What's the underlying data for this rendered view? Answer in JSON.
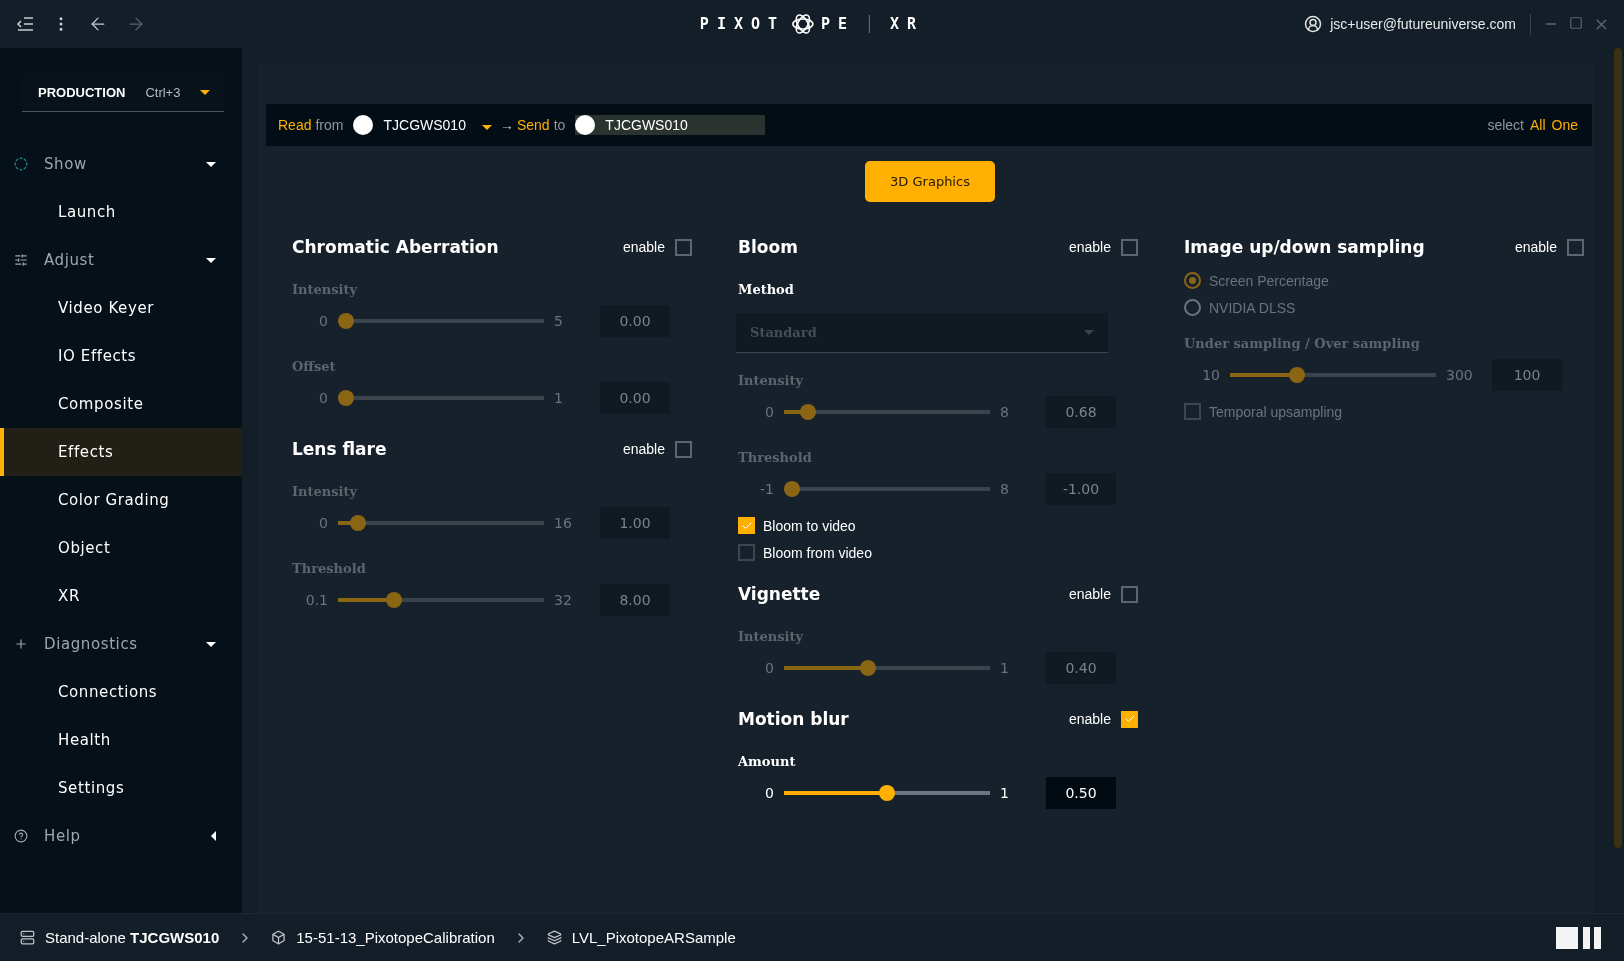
{
  "topbar": {
    "logo_left": "PIXOT",
    "logo_right": "PE",
    "product": "XR",
    "user": "jsc+user@futureuniverse.com"
  },
  "sidebar": {
    "mode": "PRODUCTION",
    "shortcut": "Ctrl+3",
    "groups": [
      {
        "label": "Show",
        "expanded": true,
        "children": [
          {
            "label": "Launch",
            "selected": false
          }
        ]
      },
      {
        "label": "Adjust",
        "expanded": true,
        "children": [
          {
            "label": "Video Keyer",
            "selected": false
          },
          {
            "label": "IO Effects",
            "selected": false
          },
          {
            "label": "Composite",
            "selected": false
          },
          {
            "label": "Effects",
            "selected": true
          },
          {
            "label": "Color Grading",
            "selected": false
          },
          {
            "label": "Object",
            "selected": false
          },
          {
            "label": "XR",
            "selected": false
          }
        ]
      },
      {
        "label": "Diagnostics",
        "expanded": true,
        "children": [
          {
            "label": "Connections",
            "selected": false
          },
          {
            "label": "Health",
            "selected": false
          },
          {
            "label": "Settings",
            "selected": false
          }
        ]
      },
      {
        "label": "Help",
        "expanded": false
      }
    ]
  },
  "route_bar": {
    "read": "Read",
    "read_suffix": "from",
    "source": "TJCGWS010",
    "send_prefix": "→",
    "send_word": "Send",
    "send_suffix": "to",
    "target": "TJCGWS010",
    "select": "select",
    "all": "All",
    "one": "One"
  },
  "category_button": "3D Graphics",
  "columns": [
    [
      {
        "title": "Chromatic Aberration",
        "enable_label": "enable",
        "enabled": false,
        "items": [
          {
            "kind": "slider",
            "label": "Intensity",
            "min": "0",
            "max": "5",
            "value": "0.00",
            "level": 0
          },
          {
            "kind": "slider",
            "label": "Offset",
            "min": "0",
            "max": "1",
            "value": "0.00",
            "level": 0
          }
        ]
      },
      {
        "title": "Lens flare",
        "enable_label": "enable",
        "enabled": false,
        "items": [
          {
            "kind": "slider",
            "label": "Intensity",
            "min": "0",
            "max": "16",
            "value": "1.00",
            "level": 0.0625
          },
          {
            "kind": "slider",
            "label": "Threshold",
            "min": "0.1",
            "max": "32",
            "value": "8.00",
            "level": 0.25
          }
        ]
      }
    ],
    [
      {
        "title": "Bloom",
        "enable_label": "enable",
        "enabled": false,
        "items": [
          {
            "kind": "dropdown",
            "label": "Method",
            "value": "Standard"
          },
          {
            "kind": "slider",
            "label": "Intensity",
            "min": "0",
            "max": "8",
            "value": "0.68",
            "level": 0.085
          },
          {
            "kind": "slider",
            "label": "Threshold",
            "min": "-1",
            "max": "8",
            "value": "-1.00",
            "level": 0
          },
          {
            "kind": "checkbox",
            "label": "Bloom to video",
            "checked": true
          },
          {
            "kind": "checkbox",
            "label": "Bloom from video",
            "checked": false
          }
        ]
      },
      {
        "title": "Vignette",
        "enable_label": "enable",
        "enabled": false,
        "items": [
          {
            "kind": "slider",
            "label": "Intensity",
            "min": "0",
            "max": "1",
            "value": "0.40",
            "level": 0.4
          }
        ]
      },
      {
        "title": "Motion blur",
        "enable_label": "enable",
        "enabled": true,
        "items": [
          {
            "kind": "slider",
            "label": "Amount",
            "min": "0",
            "max": "1",
            "value": "0.50",
            "level": 0.5
          }
        ]
      }
    ],
    [
      {
        "title": "Image up/down sampling",
        "enable_label": "enable",
        "enabled": false,
        "items": [
          {
            "kind": "radio",
            "label": "Screen Percentage",
            "selected": true
          },
          {
            "kind": "radio",
            "label": "NVIDIA DLSS",
            "selected": false
          },
          {
            "kind": "slider",
            "label": "Under sampling / Over sampling",
            "min": "10",
            "max": "300",
            "value": "100",
            "level": 0.31
          },
          {
            "kind": "checkbox",
            "label": "Temporal upsampling",
            "checked": false
          }
        ]
      }
    ]
  ],
  "status_bar": [
    {
      "kind": "machine",
      "label": "Stand-alone **TJCGWS010**"
    },
    {
      "kind": "project",
      "label": "15-51-13_PixotopeCalibration"
    },
    {
      "kind": "level",
      "label": "LVL_PixotopeARSample"
    }
  ]
}
